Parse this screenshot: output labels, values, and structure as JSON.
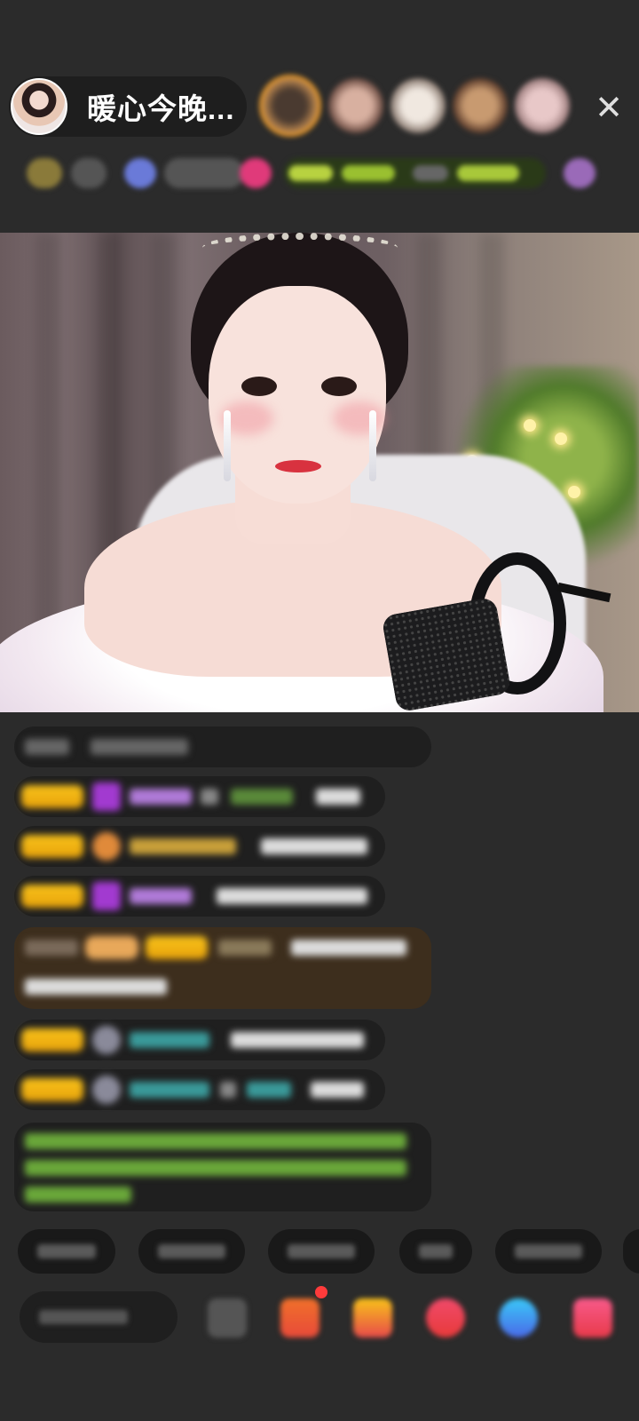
{
  "header": {
    "streamer_name": "暖心今晚...",
    "close_icon": "close-icon",
    "top_viewer_count": 5
  },
  "colors": {
    "background": "#2b2b2b",
    "badge_gold": "#f8c21a",
    "highlight_brown": "#3d2e1d",
    "notification_red": "#ff3b3b"
  },
  "chat": {
    "message_count": 9
  },
  "quick_reply_count": 5,
  "bottom_bar": {
    "tools": [
      "emoji-icon",
      "gift-box-icon",
      "gift-icon",
      "game-icon",
      "controller-icon",
      "more-gifts-icon"
    ]
  }
}
